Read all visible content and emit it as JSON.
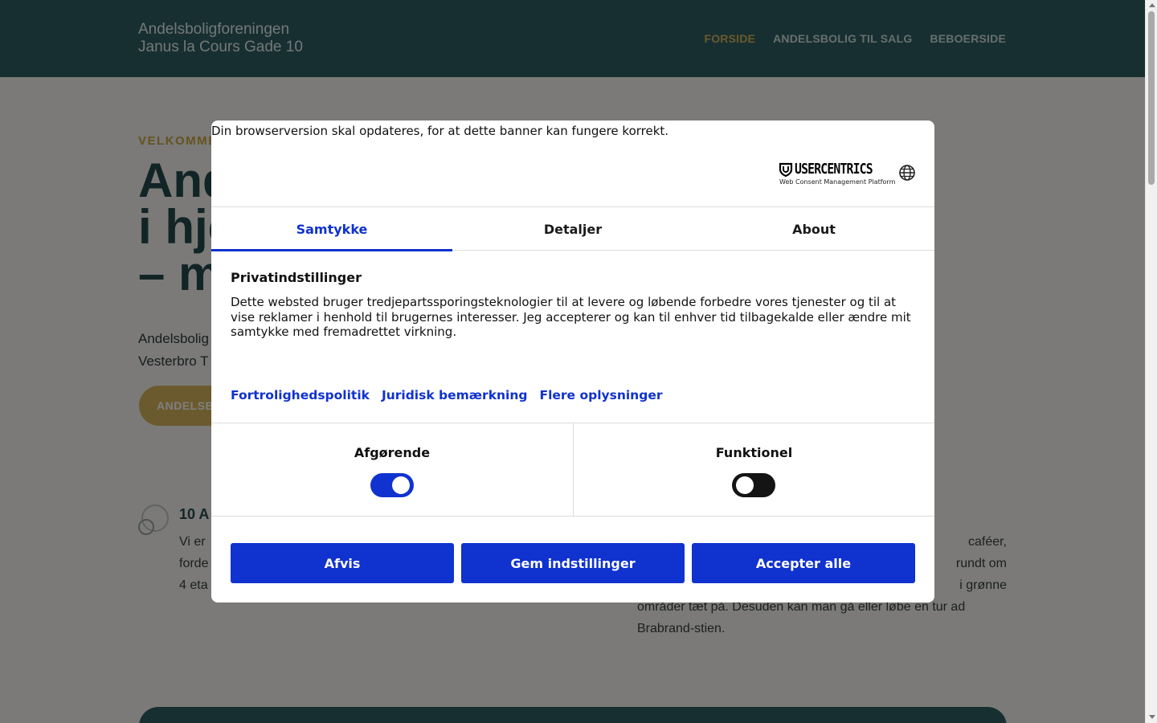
{
  "site": {
    "logo_line1": "Andelsboligforeningen",
    "logo_line2": "Janus la Cours Gade 10",
    "nav": [
      {
        "label": "FORSIDE",
        "active": true
      },
      {
        "label": "ANDELSBOLIG TIL SALG",
        "active": false
      },
      {
        "label": "BEBOERSIDE",
        "active": false
      }
    ],
    "eyebrow": "VELKOMMEN",
    "hero_title_lines": [
      "And",
      "i hje",
      "– m"
    ],
    "hero_text_lines": [
      "Andelsbolig",
      "Vesterbro T"
    ],
    "hero_button": "ANDELSBOL",
    "feature_title": "10 A",
    "feature_text_lines": [
      "Vi er",
      "forde",
      "4 eta"
    ],
    "right_text_lines": [
      "caféer,",
      "rundt om",
      "i grønne",
      "områder tæt på. Desuden kan man gå eller løbe en tur ad",
      "Brabrand-stien."
    ]
  },
  "consent": {
    "update_notice": "Din browserversion skal opdateres, for at dette banner kan fungere korrekt.",
    "brand": "USERCENTRICS",
    "brand_tagline": "Web Consent Management Platform",
    "tabs": [
      {
        "label": "Samtykke",
        "active": true
      },
      {
        "label": "Detaljer",
        "active": false
      },
      {
        "label": "About",
        "active": false
      }
    ],
    "privacy_title": "Privatindstillinger",
    "privacy_text": "Dette websted bruger tredjepartssporingsteknologier til at levere og løbende forbedre vores tjenester og til at vise reklamer i henhold til brugernes interesser. Jeg accepterer og kan til enhver tid tilbagekalde eller ændre mit samtykke med fremadrettet virkning.",
    "links": [
      "Fortrolighedspolitik",
      "Juridisk bemærkning",
      "Flere oplysninger"
    ],
    "categories": [
      {
        "label": "Afgørende",
        "enabled": true
      },
      {
        "label": "Funktionel",
        "enabled": false
      }
    ],
    "buttons": {
      "deny": "Afvis",
      "save": "Gem indstillinger",
      "accept": "Accepter alle"
    }
  },
  "colors": {
    "header": "#2f5e60",
    "accent_gold": "#d6b55a",
    "consent_blue": "#1032cf"
  }
}
